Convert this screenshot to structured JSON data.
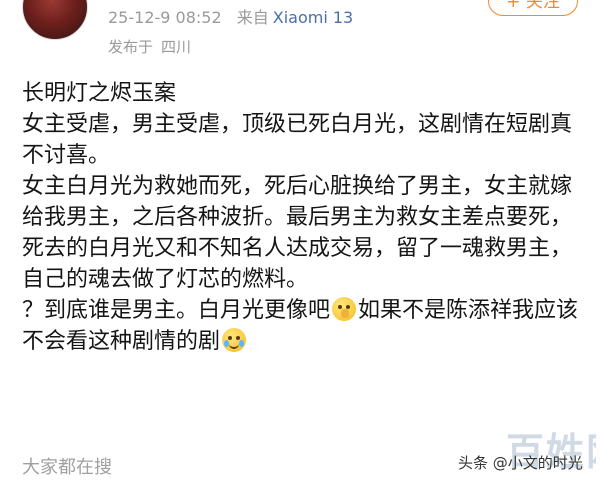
{
  "header": {
    "timestamp": "25-12-9 08:52",
    "source_prefix": "来自",
    "device": "Xiaomi 13",
    "location_prefix": "发布于",
    "location": "四川",
    "follow_label": "+ 关注"
  },
  "post": {
    "lines": [
      "长明灯之烬玉案",
      "女主受虐，男主受虐，顶级已死白月光，这剧情在短剧真不讨喜。",
      "女主白月光为救她而死，死后心脏换给了男主，女主就嫁给我男主，之后各种波折。最后男主为救女主差点要死，死去的白月光又和不知名人达成交易，留了一魂救男主，自己的魂去做了灯芯的燃料。"
    ],
    "line4_part1": "？到底谁是男主。白月光更像吧",
    "emoji1": "pray-emoji",
    "line4_part2": "如果不是陈添祥我应该不会看这种剧情的剧",
    "emoji2": "crying-laughing-emoji"
  },
  "footer": {
    "related_label": "大家都在搜",
    "watermark_text": "头条 @小文的时光",
    "watermark_logo": "百姓网"
  },
  "colors": {
    "accent_follow": "#f08a2c",
    "device_link": "#4a6fa8",
    "meta_gray": "#9a9a9a"
  }
}
